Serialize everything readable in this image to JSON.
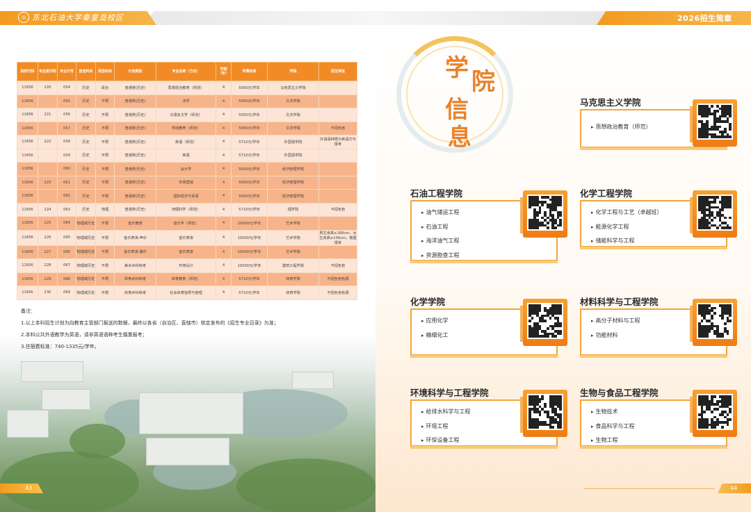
{
  "header": {
    "school_name": "东北石油大学秦皇岛校区",
    "brochure_title": "2026招生简章"
  },
  "left": {
    "table": {
      "headers": [
        "院校代码",
        "专业组代码",
        "专业代号",
        "首选科目",
        "再选科目",
        "计划类别",
        "专业名称（方向）",
        "学制（年）",
        "学费标准",
        "学院",
        "招生特征"
      ],
      "rows": [
        {
          "c": "11656",
          "g": "220",
          "m": "054",
          "s1": "历史",
          "s2": "政治",
          "t": "普通类(历史)",
          "n": "思想政治教育（师范）",
          "y": "4",
          "f": "5050元/学年",
          "col": "马克思主义学院",
          "note": "",
          "shade": "light"
        },
        {
          "c": "11656",
          "g": "",
          "m": "055",
          "s1": "历史",
          "s2": "不限",
          "t": "普通类(历史)",
          "n": "法学",
          "y": "4",
          "f": "5050元/学年",
          "col": "文法学院",
          "note": "",
          "shade": "shade"
        },
        {
          "c": "11656",
          "g": "221",
          "m": "056",
          "s1": "历史",
          "s2": "不限",
          "t": "普通类(历史)",
          "n": "汉语言文学（师范）",
          "y": "4",
          "f": "5050元/学年",
          "col": "文法学院",
          "note": "",
          "shade": "light"
        },
        {
          "c": "11656",
          "g": "",
          "m": "057",
          "s1": "历史",
          "s2": "不限",
          "t": "普通类(历史)",
          "n": "学前教育（师范）",
          "y": "4",
          "f": "5050元/学年",
          "col": "文法学院",
          "note": "不招色盲",
          "shade": "shade"
        },
        {
          "c": "11656",
          "g": "222",
          "m": "058",
          "s1": "历史",
          "s2": "不限",
          "t": "普通类(历史)",
          "n": "英语（师范）",
          "y": "4",
          "f": "5710元/学年",
          "col": "外国语学院",
          "note": "外语语种限为英语方可报考",
          "shade": "light"
        },
        {
          "c": "11656",
          "g": "",
          "m": "059",
          "s1": "历史",
          "s2": "不限",
          "t": "普通类(历史)",
          "n": "英语",
          "y": "4",
          "f": "5710元/学年",
          "col": "外国语学院",
          "note": "",
          "shade": "light"
        },
        {
          "c": "11656",
          "g": "",
          "m": "060",
          "s1": "历史",
          "s2": "不限",
          "t": "普通类(历史)",
          "n": "会计学",
          "y": "4",
          "f": "5050元/学年",
          "col": "经济管理学院",
          "note": "",
          "shade": "shade"
        },
        {
          "c": "11656",
          "g": "223",
          "m": "061",
          "s1": "历史",
          "s2": "不限",
          "t": "普通类(历史)",
          "n": "市场营销",
          "y": "4",
          "f": "5050元/学年",
          "col": "经济管理学院",
          "note": "",
          "shade": "shade"
        },
        {
          "c": "11656",
          "g": "",
          "m": "062",
          "s1": "历史",
          "s2": "不限",
          "t": "普通类(历史)",
          "n": "国际经济与贸易",
          "y": "4",
          "f": "5050元/学年",
          "col": "经济管理学院",
          "note": "",
          "shade": "shade"
        },
        {
          "c": "11656",
          "g": "224",
          "m": "063",
          "s1": "历史",
          "s2": "地理",
          "t": "普通类(历史)",
          "n": "地理科学（师范）",
          "y": "4",
          "f": "5710元/学年",
          "col": "理学院",
          "note": "不招色盲",
          "shade": "light"
        },
        {
          "c": "11656",
          "g": "225",
          "m": "064",
          "s1": "物理或历史",
          "s2": "不限",
          "t": "音乐教育",
          "n": "音乐学（师范）",
          "y": "4",
          "f": "10000元/学年",
          "col": "艺术学院",
          "note": "",
          "shade": "shade"
        },
        {
          "c": "11656",
          "g": "226",
          "m": "065",
          "s1": "物理或历史",
          "s2": "不限",
          "t": "音乐表演-声乐",
          "n": "音乐表演",
          "y": "4",
          "f": "10000元/学年",
          "col": "艺术学院",
          "note": "男生身高≥168cm，女生身高≥156cm，慎重报考",
          "shade": "light"
        },
        {
          "c": "11656",
          "g": "227",
          "m": "066",
          "s1": "物理或历史",
          "s2": "不限",
          "t": "音乐表演-器乐",
          "n": "音乐表演",
          "y": "4",
          "f": "10000元/学年",
          "col": "艺术学院",
          "note": "",
          "shade": "shade"
        },
        {
          "c": "11656",
          "g": "228",
          "m": "067",
          "s1": "物理或历史",
          "s2": "不限",
          "t": "美术术科统考",
          "n": "环境设计",
          "y": "4",
          "f": "10000元/学年",
          "col": "建筑工程学院",
          "note": "不招色盲",
          "shade": "light"
        },
        {
          "c": "11656",
          "g": "229",
          "m": "068",
          "s1": "物理或历史",
          "s2": "不限",
          "t": "体育术科统考",
          "n": "体育教育（师范）",
          "y": "4",
          "f": "5710元/学年",
          "col": "体育学院",
          "note": "不招色盲色弱",
          "shade": "shade"
        },
        {
          "c": "11656",
          "g": "230",
          "m": "069",
          "s1": "物理或历史",
          "s2": "不限",
          "t": "体育术科统考",
          "n": "社会体育指导与管理",
          "y": "4",
          "f": "5710元/学年",
          "col": "体育学院",
          "note": "不招色盲色弱",
          "shade": "light"
        }
      ]
    },
    "notes": {
      "title": "备注：",
      "n1": "1.以上本科招生计划为向教育主管部门报送的数据，最终以各省（自治区、直辖市）核定发布的《招生专业目录》为准；",
      "n2": "2.本科公共外语教学为英语，请非英语语种考生慎重报考；",
      "n3": "3.住宿费标准：740-1335元/学年。"
    },
    "page_number": "43"
  },
  "right": {
    "section_title": [
      "学",
      "院",
      "信",
      "息"
    ],
    "colleges": [
      {
        "name": "马克思主义学院",
        "majors": [
          "思想政治教育（师范）"
        ]
      },
      {
        "name": "石油工程学院",
        "majors": [
          "油气储运工程",
          "石油工程",
          "海洋油气工程",
          "资源勘查工程"
        ]
      },
      {
        "name": "化学工程学院",
        "majors": [
          "化学工程与工艺（卓越班）",
          "能源化学工程",
          "储能科学与工程"
        ]
      },
      {
        "name": "化学学院",
        "majors": [
          "应用化学",
          "精细化工"
        ]
      },
      {
        "name": "材料科学与工程学院",
        "majors": [
          "高分子材料与工程",
          "功能材料"
        ]
      },
      {
        "name": "环境科学与工程学院",
        "majors": [
          "给排水科学与工程",
          "环境工程",
          "环保设备工程"
        ]
      },
      {
        "name": "生物与食品工程学院",
        "majors": [
          "生物技术",
          "食品科学与工程",
          "生物工程"
        ]
      }
    ],
    "page_number": "44"
  }
}
